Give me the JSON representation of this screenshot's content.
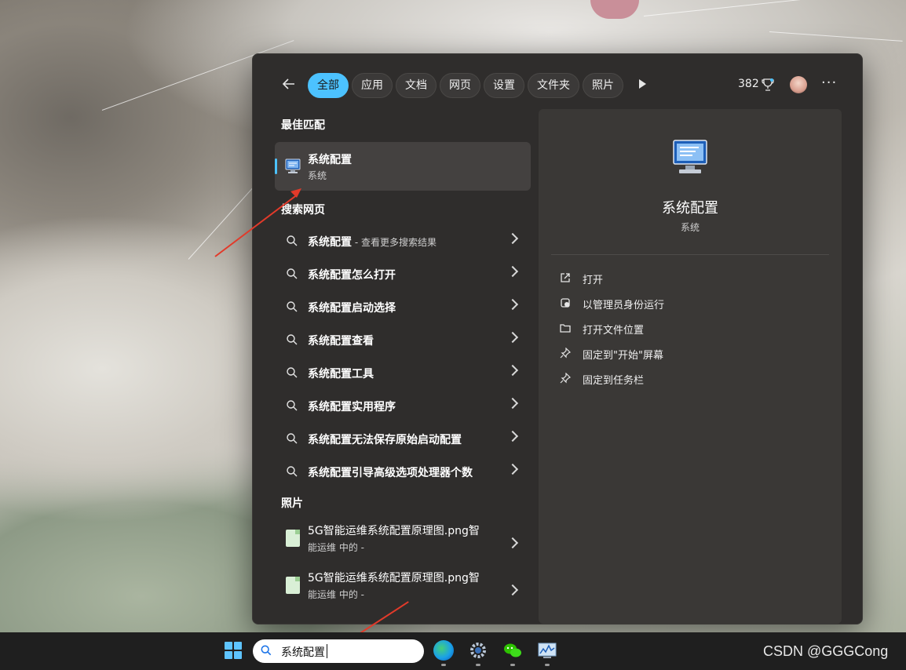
{
  "filters": {
    "tabs": [
      "全部",
      "应用",
      "文档",
      "网页",
      "设置",
      "文件夹",
      "照片"
    ],
    "active_index": 0,
    "points": "382"
  },
  "sections": {
    "best_match": "最佳匹配",
    "web_search": "搜索网页",
    "photos": "照片"
  },
  "best_match": {
    "title": "系统配置",
    "subtitle": "系统"
  },
  "web_results": [
    {
      "text": "系统配置",
      "suffix": " - 查看更多搜索结果"
    },
    {
      "text": "系统配置怎么打开",
      "suffix": ""
    },
    {
      "text": "系统配置启动选择",
      "suffix": ""
    },
    {
      "text": "系统配置查看",
      "suffix": ""
    },
    {
      "text": "系统配置工具",
      "suffix": ""
    },
    {
      "text": "系统配置实用程序",
      "suffix": ""
    },
    {
      "text": "系统配置无法保存原始启动配置",
      "suffix": ""
    },
    {
      "text": "系统配置引导高级选项处理器个数",
      "suffix": ""
    }
  ],
  "photo_results": [
    {
      "line1": "5G智能运维系统配置原理图.png智",
      "line2": "能运维 中的 -"
    },
    {
      "line1": "5G智能运维系统配置原理图.png智",
      "line2": "能运维 中的 -"
    }
  ],
  "preview": {
    "title": "系统配置",
    "subtitle": "系统",
    "actions": [
      {
        "label": "打开",
        "icon": "open-external-icon"
      },
      {
        "label": "以管理员身份运行",
        "icon": "admin-shield-icon"
      },
      {
        "label": "打开文件位置",
        "icon": "folder-icon"
      },
      {
        "label": "固定到\"开始\"屏幕",
        "icon": "pin-icon"
      },
      {
        "label": "固定到任务栏",
        "icon": "pin-icon"
      }
    ]
  },
  "taskbar": {
    "search_query": "系统配置"
  },
  "watermark": "CSDN @GGGCong",
  "colors": {
    "accent": "#4cc2ff",
    "annotation_arrow": "#e23a2a"
  }
}
